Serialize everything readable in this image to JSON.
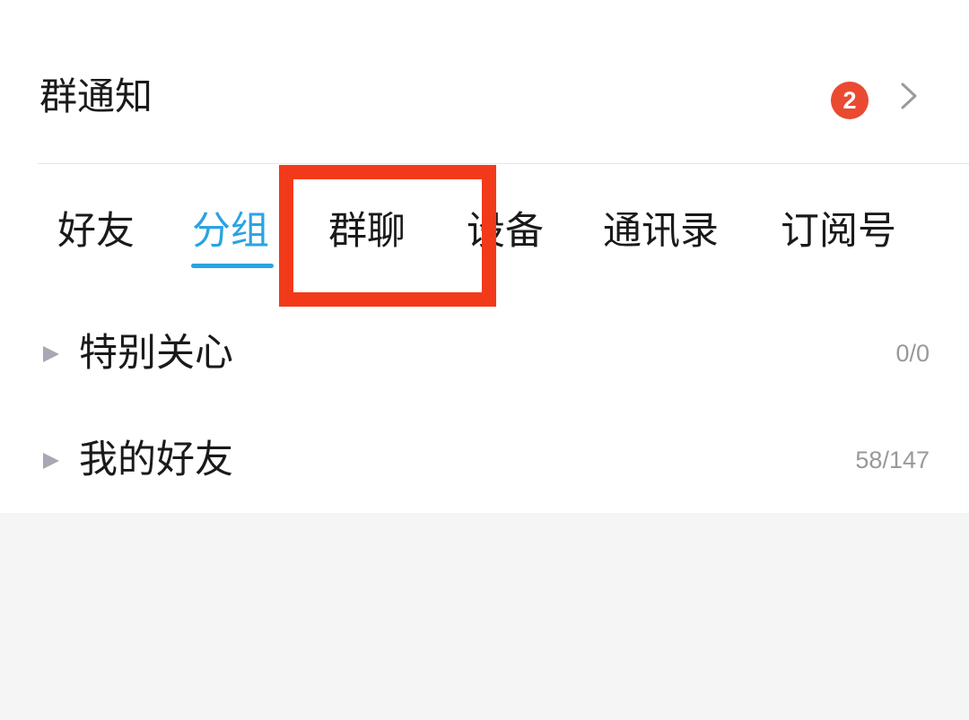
{
  "notice": {
    "title": "群通知",
    "badge_count": "2",
    "icons": {
      "chevron": "chevron-right-icon"
    },
    "colors": {
      "badge": "#ea4a31"
    }
  },
  "tabs": [
    {
      "label": "好友",
      "active": false
    },
    {
      "label": "分组",
      "active": true
    },
    {
      "label": "群聊",
      "active": false,
      "highlighted": true
    },
    {
      "label": "设备",
      "active": false
    },
    {
      "label": "通讯录",
      "active": false
    },
    {
      "label": "订阅号",
      "active": false
    }
  ],
  "tab_colors": {
    "active": "#2aa3e2",
    "highlight_box": "#f23a1a"
  },
  "groups": [
    {
      "name": "特别关心",
      "count": "0/0",
      "icon": "expand-triangle-icon"
    },
    {
      "name": "我的好友",
      "count": "58/147",
      "icon": "expand-triangle-icon"
    }
  ]
}
